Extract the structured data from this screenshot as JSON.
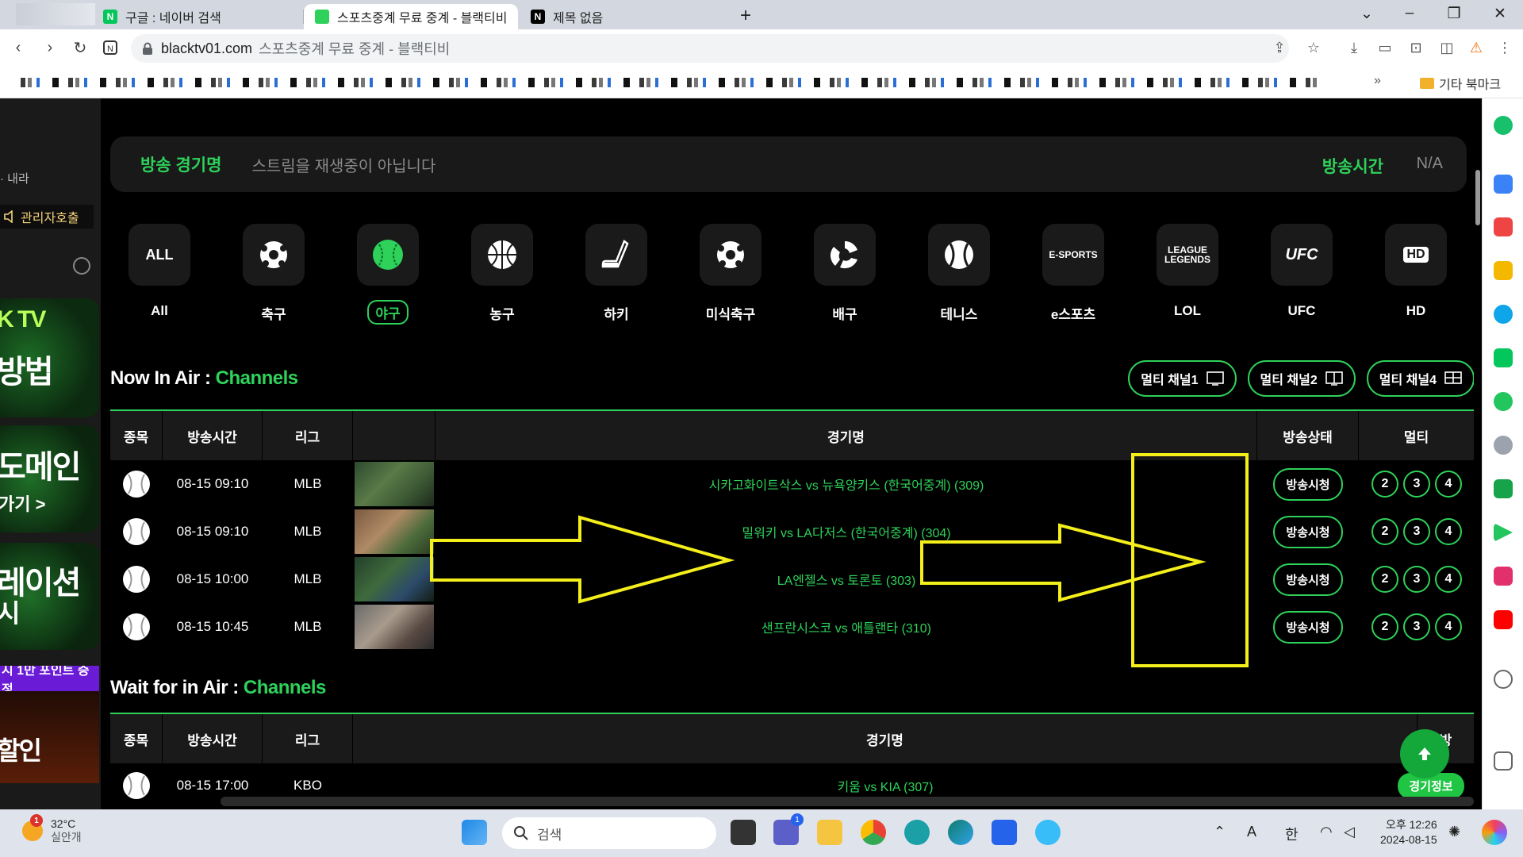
{
  "browser": {
    "tabs": [
      {
        "title": "구글 : 네이버 검색",
        "favicon": "N",
        "favicon_color": "#03c75a",
        "active": false
      },
      {
        "title": "스포츠중계 무료 중계 - 블랙티비",
        "favicon": "▌▌",
        "favicon_color": "#2ed15a",
        "active": true
      },
      {
        "title": "제목 없음",
        "favicon": "N",
        "favicon_color": "#000000",
        "active": false
      }
    ],
    "address": {
      "host": "blacktv01.com",
      "title": "스포츠중계 무료 중계 - 블랙티비"
    },
    "bookmarks_folder": "기타 북마크"
  },
  "sidebar_left": {
    "partial_text": "내라",
    "admin_label": "관리자호출",
    "banners": [
      {
        "big": "K TV",
        "small": "방법"
      },
      {
        "big": "도메인",
        "small": "가기 >"
      },
      {
        "big": "레이션",
        "small": "시"
      },
      {
        "strip": "시 1만 포인트 증정"
      },
      {
        "big": "할인",
        "small": ""
      }
    ]
  },
  "status_bar": {
    "game_label": "방송 경기명",
    "game_message": "스트림을 재생중이 아닙니다",
    "time_label": "방송시간",
    "time_value": "N/A"
  },
  "sports": [
    {
      "label": "All",
      "icon": "ALL",
      "selected": false
    },
    {
      "label": "축구",
      "icon": "soccer-icon",
      "selected": false
    },
    {
      "label": "야구",
      "icon": "baseball-icon",
      "selected": true
    },
    {
      "label": "농구",
      "icon": "basketball-icon",
      "selected": false
    },
    {
      "label": "하키",
      "icon": "hockey-icon",
      "selected": false
    },
    {
      "label": "미식축구",
      "icon": "football-icon",
      "selected": false
    },
    {
      "label": "배구",
      "icon": "volleyball-icon",
      "selected": false
    },
    {
      "label": "테니스",
      "icon": "tennis-icon",
      "selected": false
    },
    {
      "label": "e스포츠",
      "icon": "E-SPORTS",
      "selected": false
    },
    {
      "label": "LOL",
      "icon": "LEAGUE LEGENDS",
      "selected": false
    },
    {
      "label": "UFC",
      "icon": "UFC",
      "selected": false
    },
    {
      "label": "HD",
      "icon": "HD",
      "selected": false
    }
  ],
  "now_in_air": {
    "title_prefix": "Now In Air : ",
    "title_accent": "Channels",
    "multi_buttons": [
      "멀티 채널1",
      "멀티 채널2",
      "멀티 채널4"
    ],
    "columns": [
      "종목",
      "방송시간",
      "리그",
      "",
      "경기명",
      "방송상태",
      "멀티"
    ],
    "rows": [
      {
        "time": "08-15 09:10",
        "league": "MLB",
        "game": "시카고화이트삭스 vs 뉴욕양키스 (한국어중계) (309)",
        "status": "방송시청",
        "multi": [
          "2",
          "3",
          "4"
        ]
      },
      {
        "time": "08-15 09:10",
        "league": "MLB",
        "game": "밀워키 vs LA다저스 (한국어중계) (304)",
        "status": "방송시청",
        "multi": [
          "2",
          "3",
          "4"
        ]
      },
      {
        "time": "08-15 10:00",
        "league": "MLB",
        "game": "LA엔젤스 vs 토론토 (303)",
        "status": "방송시청",
        "multi": [
          "2",
          "3",
          "4"
        ]
      },
      {
        "time": "08-15 10:45",
        "league": "MLB",
        "game": "샌프란시스코 vs 애틀랜타 (310)",
        "status": "방송시청",
        "multi": [
          "2",
          "3",
          "4"
        ]
      }
    ]
  },
  "wait_for_air": {
    "title_prefix": "Wait for in Air : ",
    "title_accent": "Channels",
    "columns": [
      "종목",
      "방송시간",
      "리그",
      "경기명",
      "방"
    ],
    "rows": [
      {
        "time": "08-15 17:00",
        "league": "KBO",
        "game": "키움 vs KIA (307)",
        "status": "경기정보"
      }
    ]
  },
  "taskbar": {
    "weather_temp": "32°C",
    "weather_desc": "실안개",
    "weather_badge": "1",
    "search_placeholder": "검색",
    "ime_a": "A",
    "ime_lang": "한",
    "clock_time": "오후 12:26",
    "clock_date": "2024-08-15",
    "chat_badge": "1"
  },
  "colors": {
    "accent_green": "#2ed15a",
    "annotation_yellow": "#f4ef1b"
  }
}
